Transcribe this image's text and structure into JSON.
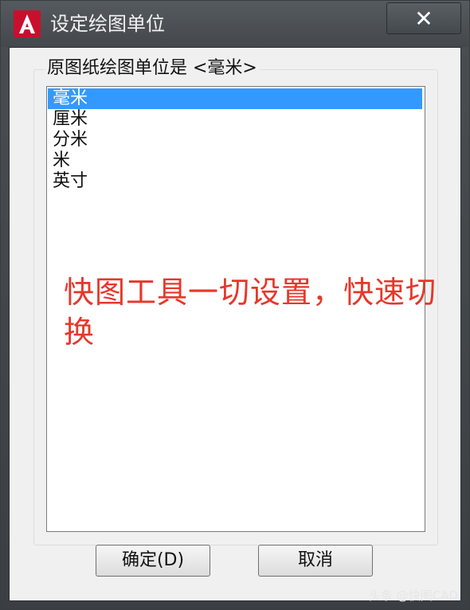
{
  "window": {
    "title": "设定绘图单位",
    "app_icon": "autocad-logo-icon",
    "close_label": "✕",
    "title_bar_color": "#4a4e52"
  },
  "group": {
    "label": "原图纸绘图单位是 <毫米>"
  },
  "units_list": {
    "items": [
      "毫米",
      "厘米",
      "分米",
      "米",
      "英寸"
    ],
    "selected": "毫米",
    "selection_color": "#3399ff"
  },
  "overlay": {
    "text": "快图工具一切设置，快速切换",
    "color": "#e8362a"
  },
  "buttons": {
    "ok_label": "确定(D)",
    "cancel_label": "取消"
  },
  "watermark": {
    "text": "头条 @快图CAD"
  }
}
